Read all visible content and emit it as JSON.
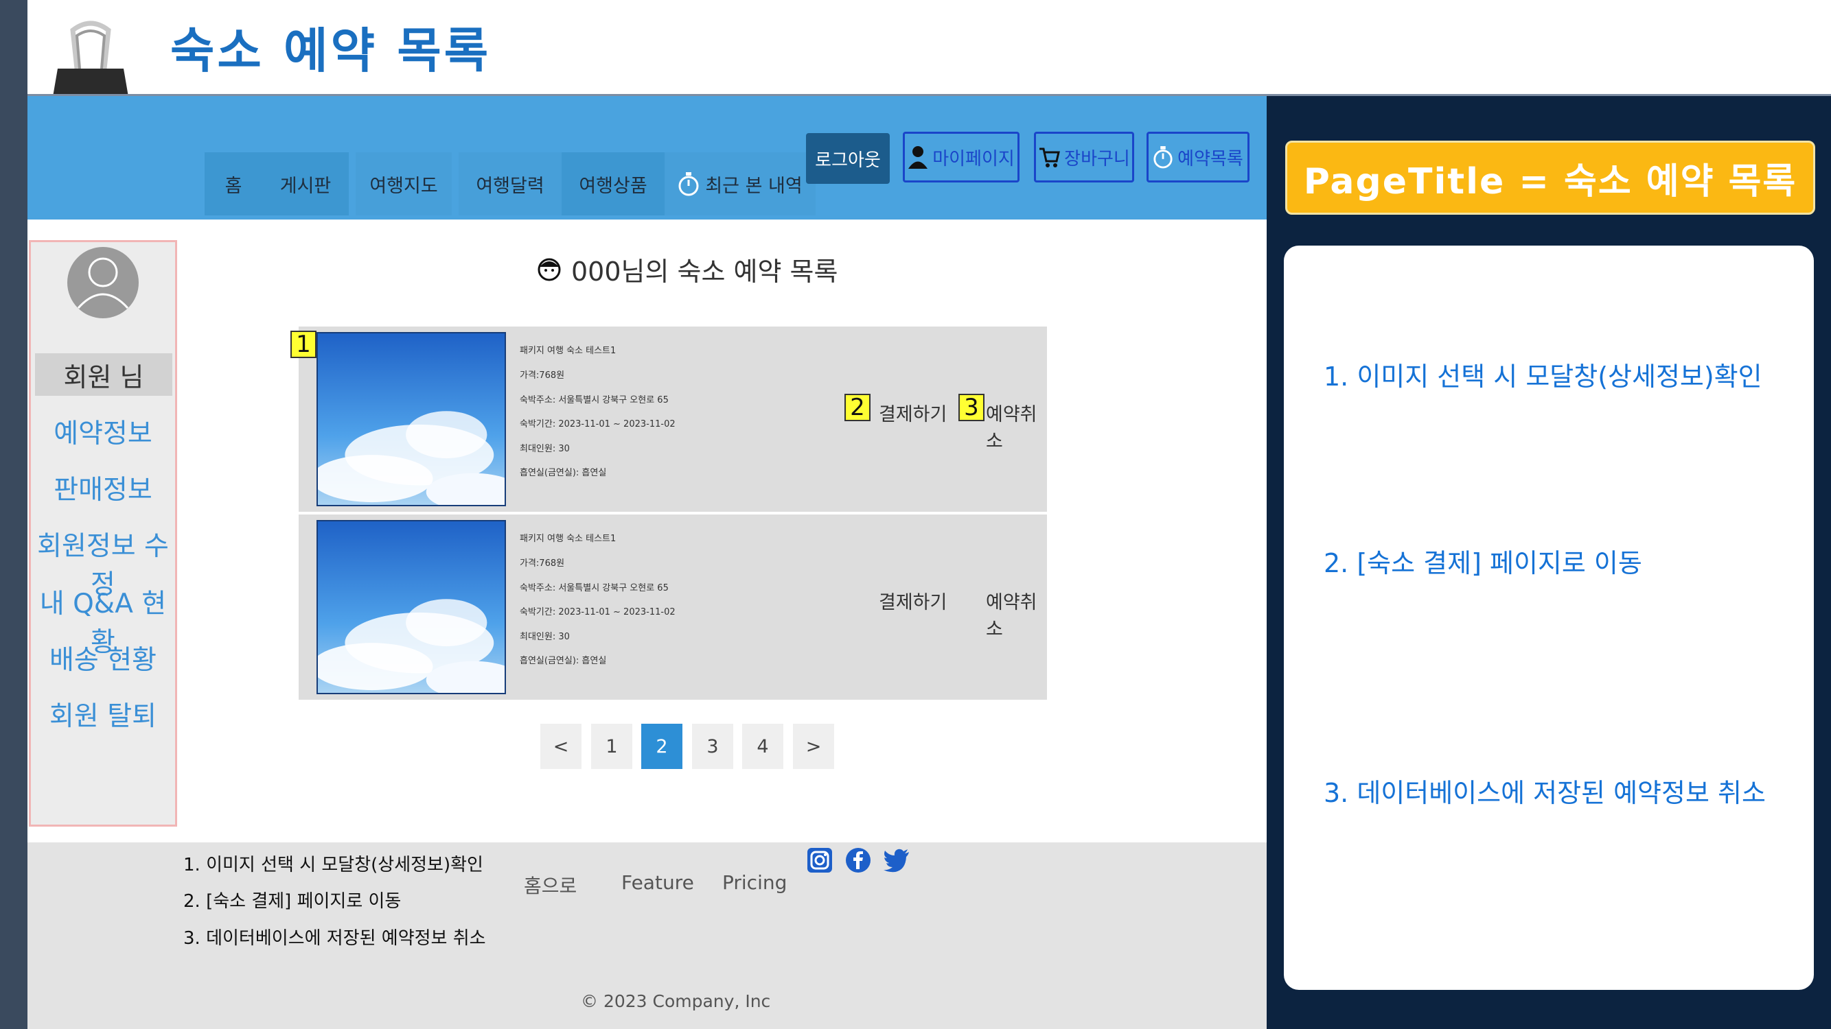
{
  "doc": {
    "title": "숙소 예약 목록"
  },
  "nav": {
    "items": [
      {
        "label": "홈"
      },
      {
        "label": "게시판"
      },
      {
        "label": "여행지도"
      },
      {
        "label": "여행달력"
      },
      {
        "label": "여행상품"
      },
      {
        "label": "최근 본 내역"
      }
    ],
    "logout": "로그아웃",
    "mypage": "마이페이지",
    "cart": "장바구니",
    "reservations": "예약목록"
  },
  "sidebar": {
    "member": "회원 님",
    "links": [
      "예약정보",
      "판매정보",
      "회원정보 수정",
      "내 Q&A 현황",
      "배송 현황",
      "회원 탈퇴"
    ]
  },
  "main": {
    "heading": "000님의 숙소 예약 목록",
    "reservations": [
      {
        "name": "패키지 여행 숙소 테스트1",
        "price": "가격:768원",
        "address": "숙박주소: 서울특별시 강북구 오현로 65",
        "period": "숙박기간: 2023-11-01 ~ 2023-11-02",
        "max_people": "최대인원: 30",
        "smoking": "흡연실(금연실): 흡연실",
        "pay_label": "결제하기",
        "cancel_label": "예약취소"
      },
      {
        "name": "패키지 여행 숙소 테스트1",
        "price": "가격:768원",
        "address": "숙박주소: 서울특별시 강북구 오현로 65",
        "period": "숙박기간: 2023-11-01 ~ 2023-11-02",
        "max_people": "최대인원: 30",
        "smoking": "흡연실(금연실): 흡연실",
        "pay_label": "결제하기",
        "cancel_label": "예약취소"
      }
    ],
    "badges": [
      "1",
      "2",
      "3"
    ],
    "pagination": {
      "prev": "<",
      "pages": [
        "1",
        "2",
        "3",
        "4"
      ],
      "next": ">",
      "current": "2"
    }
  },
  "footer": {
    "notes": [
      "1. 이미지 선택 시 모달창(상세정보)확인",
      "2. [숙소 결제] 페이지로 이동",
      "3. 데이터베이스에 저장된 예약정보 취소"
    ],
    "links": [
      "홈으로",
      "Feature",
      "Pricing"
    ],
    "copyright": "© 2023 Company, Inc",
    "social_icons": [
      "instagram-icon",
      "facebook-icon",
      "twitter-icon"
    ]
  },
  "panel": {
    "page_title": "PageTitle = 숙소 예약 목록",
    "notes": [
      "1. 이미지 선택 시 모달창(상세정보)확인",
      "2. [숙소 결제] 페이지로 이동",
      "3. 데이터베이스에 저장된 예약정보 취소"
    ]
  },
  "colors": {
    "navbar": "#4aa3df",
    "panel_bg": "#0c2340",
    "title_box": "#fbb813",
    "note_text": "#1572d6",
    "badge": "#ffff33"
  }
}
